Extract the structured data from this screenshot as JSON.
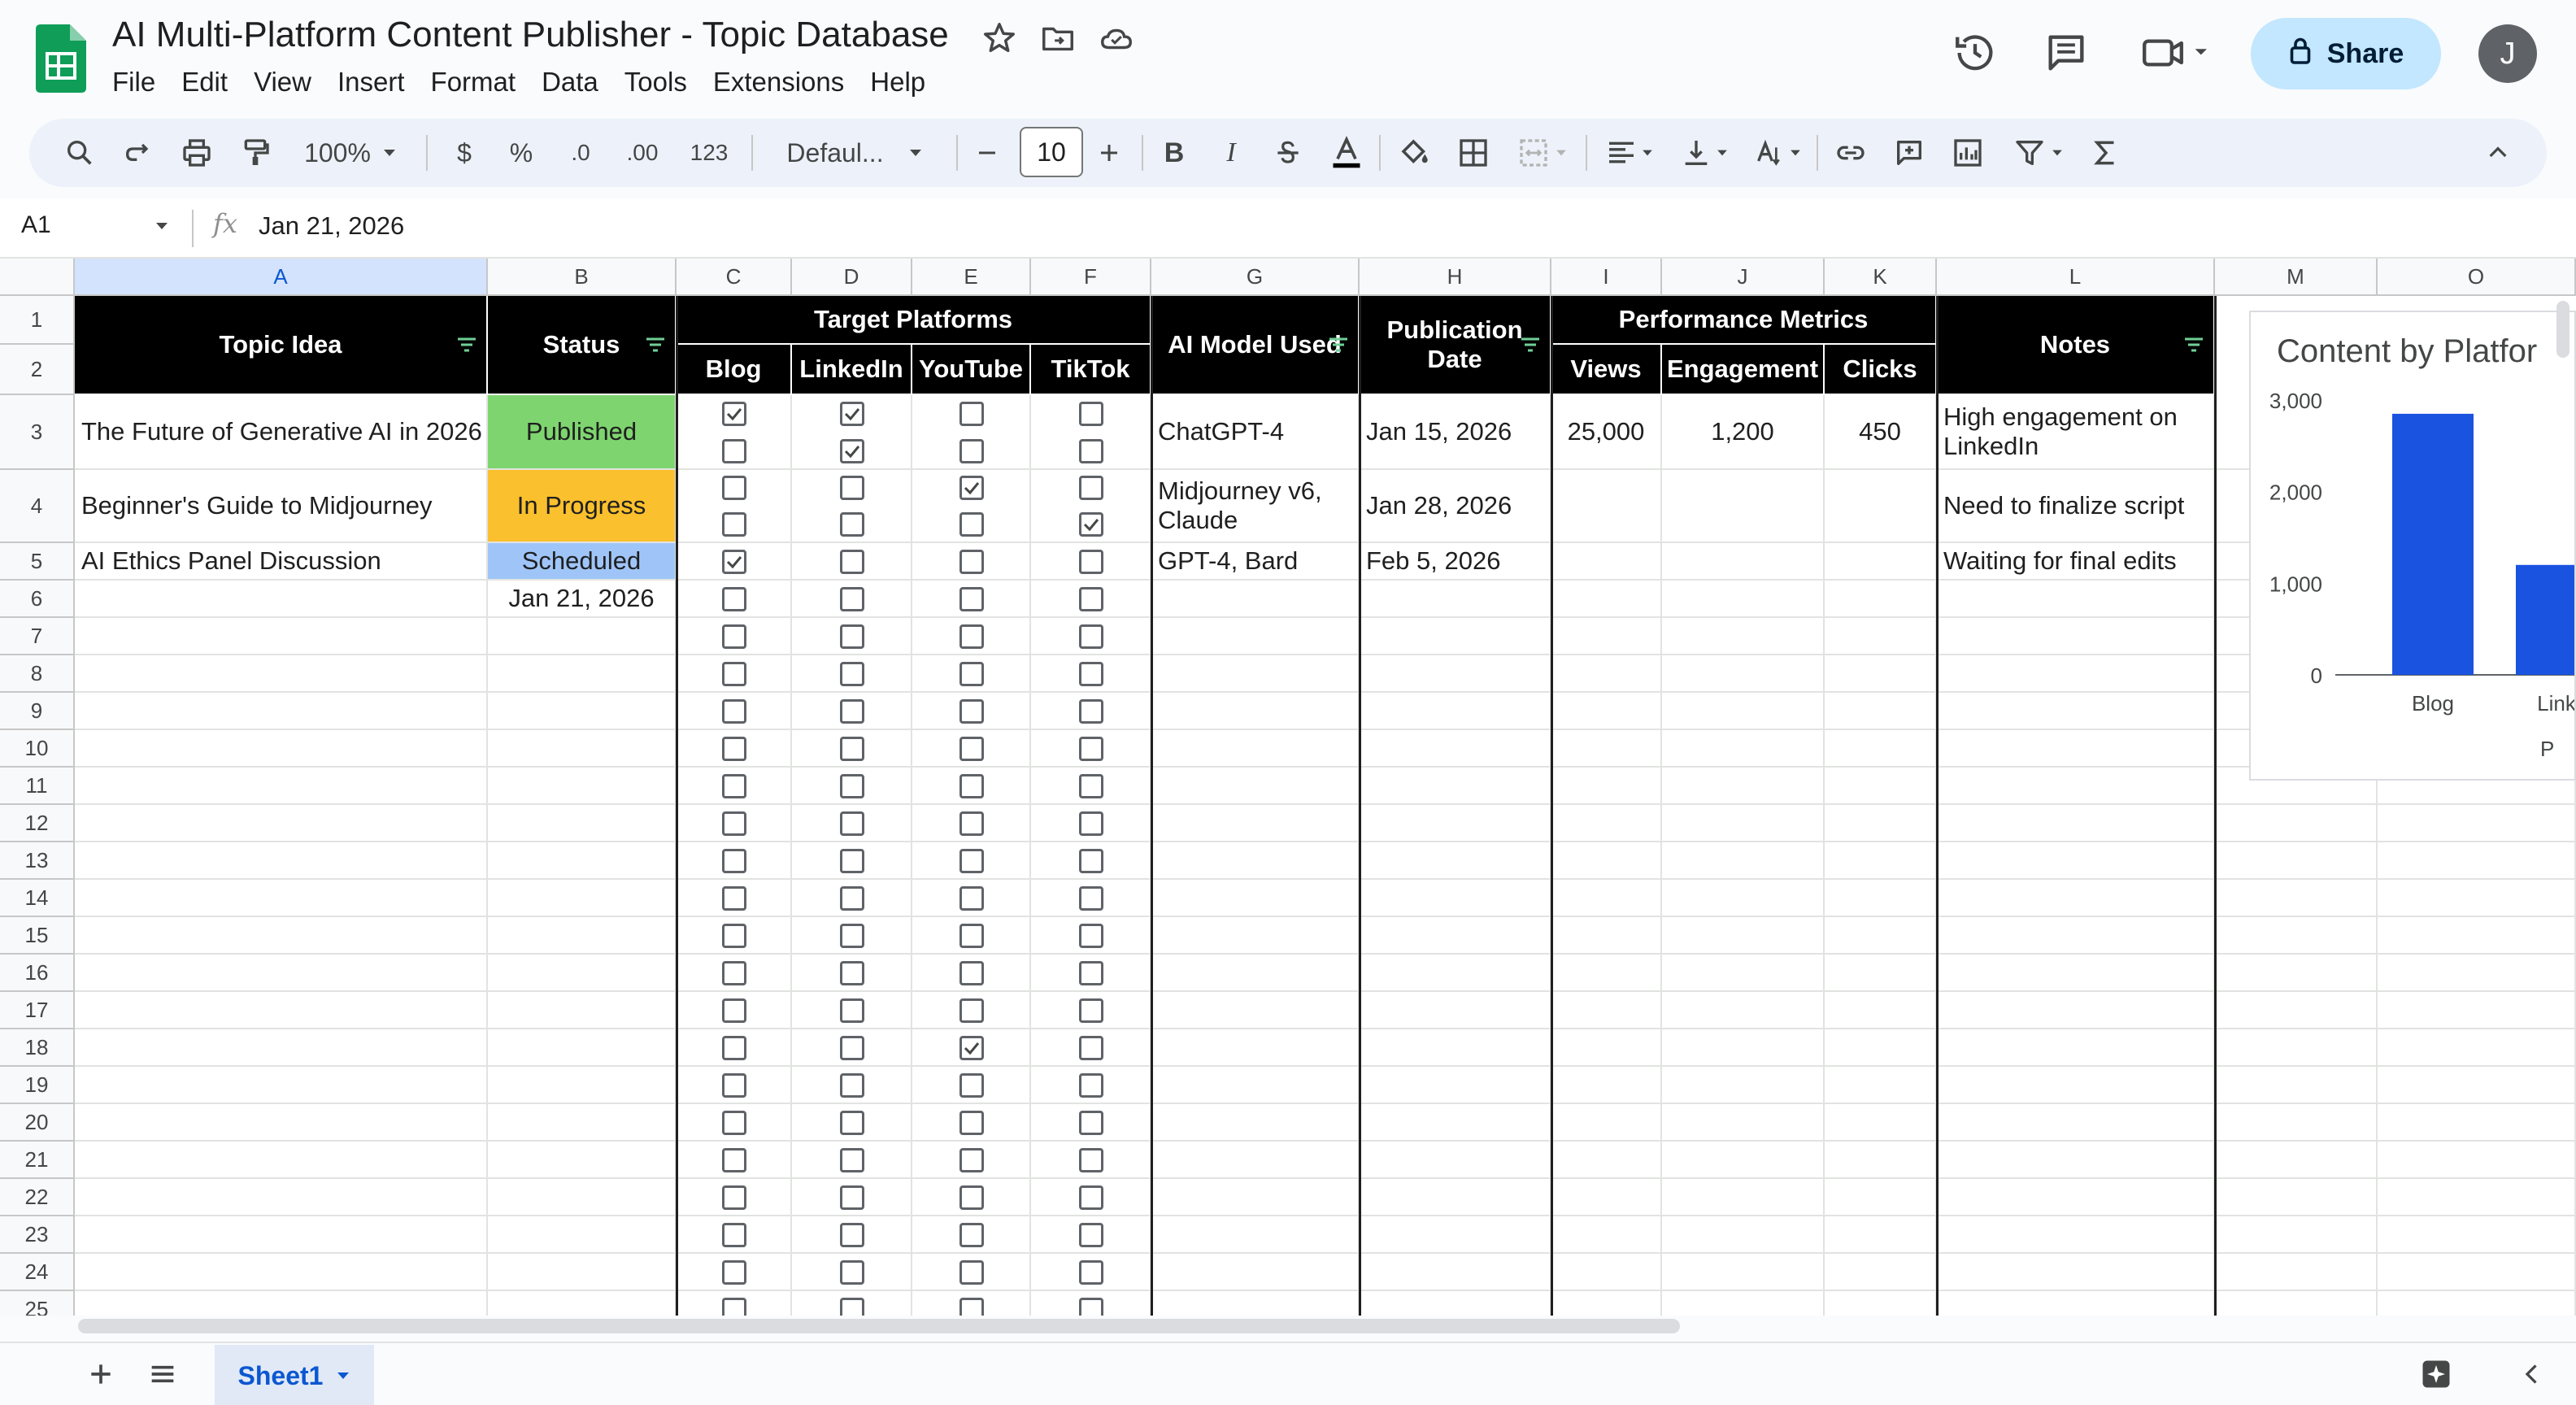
{
  "app": {
    "title": "AI Multi-Platform Content Publisher - Topic Database",
    "menu": [
      "File",
      "Edit",
      "View",
      "Insert",
      "Format",
      "Data",
      "Tools",
      "Extensions",
      "Help"
    ],
    "share_label": "Share",
    "avatar_initial": "J"
  },
  "toolbar": {
    "zoom": "100%",
    "currency": "$",
    "percent": "%",
    "decrease_decimal": ".0",
    "increase_decimal": ".00",
    "number_format": "123",
    "font": "Defaul...",
    "font_size": "10",
    "bold": "B",
    "italic": "I"
  },
  "formula_bar": {
    "cell_ref": "A1",
    "fx": "fx",
    "value": "Jan 21, 2026"
  },
  "grid": {
    "columns": [
      "A",
      "B",
      "C",
      "D",
      "E",
      "F",
      "G",
      "H",
      "I",
      "J",
      "K",
      "L",
      "M",
      "O"
    ],
    "rows": [
      "1",
      "2",
      "3",
      "4",
      "5",
      "6",
      "7",
      "8",
      "9",
      "10",
      "11",
      "12",
      "13",
      "14",
      "15",
      "16",
      "17",
      "18",
      "19",
      "20",
      "21",
      "22",
      "23",
      "24",
      "25"
    ],
    "headers": {
      "topic": "Topic Idea",
      "status": "Status",
      "target_platforms": "Target Platforms",
      "blog": "Blog",
      "linkedin": "LinkedIn",
      "youtube": "YouTube",
      "tiktok": "TikTok",
      "ai_model": "AI Model Used",
      "pub_date": "Publication Date",
      "performance": "Performance Metrics",
      "views": "Views",
      "engagement": "Engagement",
      "clicks": "Clicks",
      "notes": "Notes"
    },
    "data_rows": [
      {
        "topic": "The Future of Generative AI in 2026",
        "status": "Published",
        "status_color": "#7ed56f",
        "model": "ChatGPT-4",
        "date": "Jan 15, 2026",
        "views": "25,000",
        "engagement": "1,200",
        "clicks": "450",
        "notes": "High engagement on LinkedIn"
      },
      {
        "topic": "Beginner's Guide to Midjourney",
        "status": "In Progress",
        "status_color": "#fbc02d",
        "model": "Midjourney v6, Claude",
        "date": "Jan 28, 2026",
        "views": "",
        "engagement": "",
        "clicks": "",
        "notes": "Need to finalize script"
      },
      {
        "topic": "AI Ethics Panel Discussion",
        "status": "Scheduled",
        "status_color": "#9fc5f8",
        "model": "GPT-4, Bard",
        "date": "Feb 5, 2026",
        "views": "",
        "engagement": "",
        "clicks": "",
        "notes": "Waiting for final edits"
      }
    ],
    "b6_value": "Jan 21, 2026",
    "checked": [
      [
        0,
        0
      ],
      [
        0,
        1
      ],
      [
        1,
        1
      ],
      [
        2,
        2
      ],
      [
        3,
        3
      ],
      [
        4,
        0
      ],
      [
        17,
        2
      ]
    ]
  },
  "chart_data": {
    "type": "bar",
    "title": "Content by Platfor",
    "categories": [
      "Blog",
      "Link"
    ],
    "values": [
      2850,
      1200
    ],
    "ylim": [
      0,
      3000
    ],
    "yticks": [
      "0",
      "1,000",
      "2,000",
      "3,000"
    ],
    "xlabel": "P",
    "bar_color": "#1a53e0"
  },
  "sheets": {
    "active": "Sheet1"
  }
}
